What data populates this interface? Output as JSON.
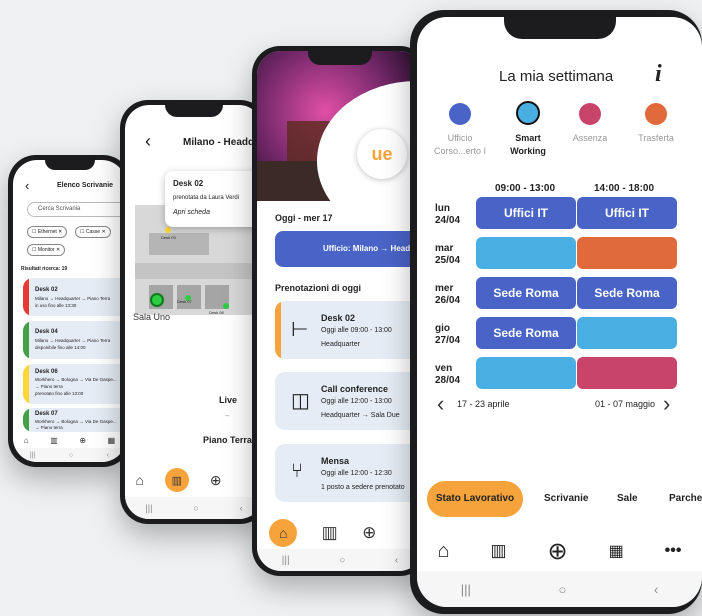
{
  "p1": {
    "title": "Elenco Scrivanie",
    "search": "Cerca Scrivania",
    "chips": [
      "Ethernet",
      "Casse",
      "Monitor"
    ],
    "results": "Risultati ricerca: 19",
    "items": [
      {
        "title": "Desk 02",
        "line1": "Milano → Headquarter → Piano Terra",
        "line2": "in uso fino alle 13:30",
        "color": "#e53935"
      },
      {
        "title": "Desk 04",
        "line1": "Milano → Headquarter → Piano Terra",
        "line2": "disponibile fino alle 14:00",
        "color": "#43a047"
      },
      {
        "title": "Desk 06",
        "line1": "Workhero → Bologna → Via De Gaspe...",
        "line2": "→ Piano terra",
        "line3": "prenotato fino alle 13:00",
        "color": "#fdd835"
      },
      {
        "title": "Desk 07",
        "line1": "Workhero → Bologna → Via De Gaspe...",
        "line2": "→ Piano terra",
        "color": "#43a047"
      }
    ]
  },
  "p2": {
    "title": "Milano - Headquarter",
    "popup_title": "Desk 02",
    "popup_sub": "prenotata da Laura Verdi",
    "popup_link": "Apri scheda",
    "room": "Sala Uno",
    "desk_a": "Desk 03",
    "desk_b": "Desk 07",
    "desk_c": "Desk 08",
    "live": "Live",
    "floor": "Piano Terra"
  },
  "p3": {
    "today": "Oggi - mer 17",
    "office": "Ufficio: Milano → Headquarter",
    "section": "Prenotazioni di oggi",
    "bookings": [
      {
        "title": "Desk 02",
        "time": "Oggi alle 09:00 - 13:00",
        "place": "Headquarter"
      },
      {
        "title": "Call conference",
        "time": "Oggi alle 12:00 - 13:00",
        "place": "Headquarter → Sala Due"
      },
      {
        "title": "Mensa",
        "time": "Oggi alle 12:00 - 12:30",
        "place": "1 posto a sedere prenotato"
      }
    ]
  },
  "p4": {
    "title": "La mia settimana",
    "info": "i",
    "legend": [
      {
        "label": "Ufficio",
        "label2": "Corso...erto I",
        "color": "#4a63c7",
        "active": false
      },
      {
        "label": "Smart",
        "label2": "Working",
        "color": "#49aee2",
        "active": true
      },
      {
        "label": "Assenza",
        "label2": "",
        "color": "#c8446b",
        "active": false
      },
      {
        "label": "Trasferta",
        "label2": "",
        "color": "#e06a3c",
        "active": false
      }
    ],
    "slot_am": "09:00 - 13:00",
    "slot_pm": "14:00 - 18:00",
    "days": [
      {
        "day": "lun",
        "date": "24/04",
        "am": "Uffici IT",
        "am_color": "#4a63c7",
        "pm": "Uffici IT",
        "pm_color": "#4a63c7"
      },
      {
        "day": "mar",
        "date": "25/04",
        "am": "",
        "am_color": "#49aee2",
        "pm": "",
        "pm_color": "#e06a3c"
      },
      {
        "day": "mer",
        "date": "26/04",
        "am": "Sede Roma",
        "am_color": "#4a63c7",
        "pm": "Sede Roma",
        "pm_color": "#4a63c7"
      },
      {
        "day": "gio",
        "date": "27/04",
        "am": "Sede Roma",
        "am_color": "#4a63c7",
        "pm": "",
        "pm_color": "#49aee2"
      },
      {
        "day": "ven",
        "date": "28/04",
        "am": "",
        "am_color": "#49aee2",
        "pm": "",
        "pm_color": "#c8446b"
      }
    ],
    "prev_week": "17 - 23 aprile",
    "next_week": "01 - 07 maggio",
    "tabs": [
      "Stato Lavorativo",
      "Scrivanie",
      "Sale",
      "Parcheggi"
    ],
    "accent": "#f7a33c"
  }
}
